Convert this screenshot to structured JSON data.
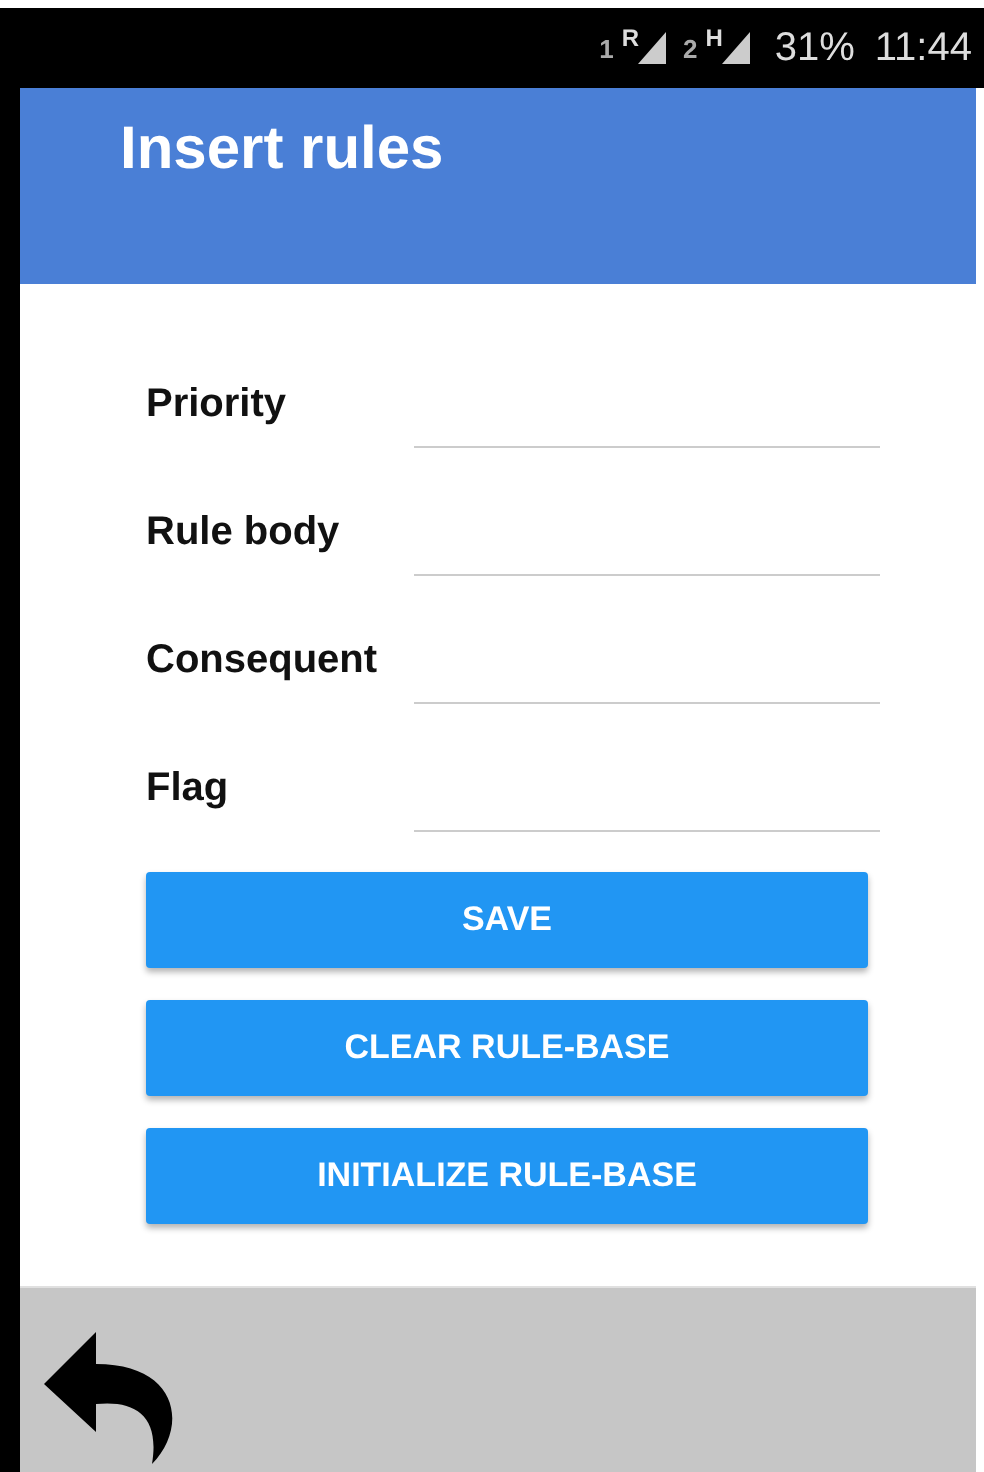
{
  "status_bar": {
    "sim1": "1",
    "sim1_network": "R",
    "sim2": "2",
    "sim2_network": "H",
    "battery": "31%",
    "time": "11:44"
  },
  "app_bar": {
    "title": "Insert rules"
  },
  "fields": [
    {
      "label": "Priority"
    },
    {
      "label": "Rule body"
    },
    {
      "label": "Consequent"
    },
    {
      "label": "Flag"
    }
  ],
  "buttons": [
    "SAVE",
    "CLEAR RULE-BASE",
    "INITIALIZE RULE-BASE"
  ]
}
